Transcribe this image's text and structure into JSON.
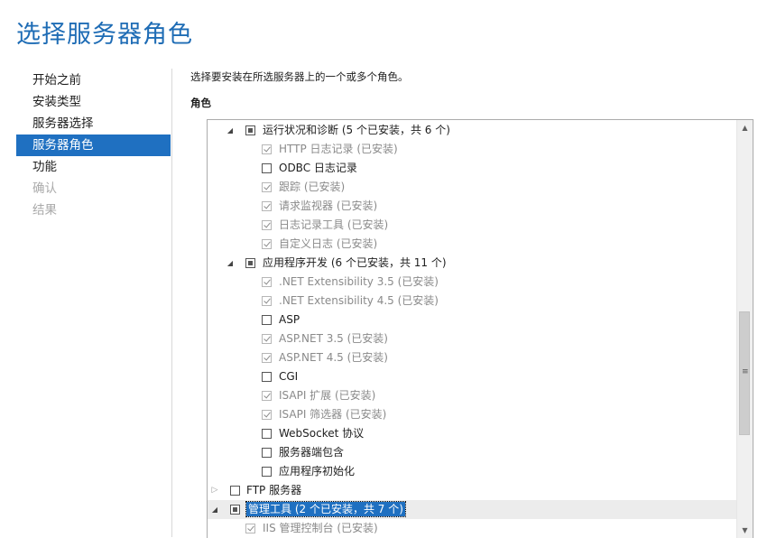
{
  "page": {
    "title": "选择服务器角色",
    "instruction": "选择要安装在所选服务器上的一个或多个角色。",
    "roles_label": "角色"
  },
  "nav": {
    "items": [
      {
        "label": "开始之前",
        "state": "normal"
      },
      {
        "label": "安装类型",
        "state": "normal"
      },
      {
        "label": "服务器选择",
        "state": "normal"
      },
      {
        "label": "服务器角色",
        "state": "active"
      },
      {
        "label": "功能",
        "state": "normal"
      },
      {
        "label": "确认",
        "state": "disabled"
      },
      {
        "label": "结果",
        "state": "disabled"
      }
    ]
  },
  "roles": {
    "rows": [
      {
        "level": 1,
        "expander": "expanded",
        "checkbox": "partial",
        "label": "运行状况和诊断 (5 个已安装，共 6 个)",
        "installed": false
      },
      {
        "level": 2,
        "checkbox": "checked",
        "label": "HTTP 日志记录 (已安装)",
        "installed": true
      },
      {
        "level": 2,
        "checkbox": "unchecked",
        "label": "ODBC 日志记录",
        "installed": false
      },
      {
        "level": 2,
        "checkbox": "checked",
        "label": "跟踪 (已安装)",
        "installed": true
      },
      {
        "level": 2,
        "checkbox": "checked",
        "label": "请求监视器 (已安装)",
        "installed": true
      },
      {
        "level": 2,
        "checkbox": "checked",
        "label": "日志记录工具 (已安装)",
        "installed": true
      },
      {
        "level": 2,
        "checkbox": "checked",
        "label": "自定义日志 (已安装)",
        "installed": true
      },
      {
        "level": 1,
        "expander": "expanded",
        "checkbox": "partial",
        "label": "应用程序开发 (6 个已安装，共 11 个)",
        "installed": false
      },
      {
        "level": 2,
        "checkbox": "checked",
        "label": ".NET Extensibility 3.5 (已安装)",
        "installed": true
      },
      {
        "level": 2,
        "checkbox": "checked",
        "label": ".NET Extensibility 4.5 (已安装)",
        "installed": true
      },
      {
        "level": 2,
        "checkbox": "unchecked",
        "label": "ASP",
        "installed": false
      },
      {
        "level": 2,
        "checkbox": "checked",
        "label": "ASP.NET 3.5 (已安装)",
        "installed": true
      },
      {
        "level": 2,
        "checkbox": "checked",
        "label": "ASP.NET 4.5 (已安装)",
        "installed": true
      },
      {
        "level": 2,
        "checkbox": "unchecked",
        "label": "CGI",
        "installed": false
      },
      {
        "level": 2,
        "checkbox": "checked",
        "label": "ISAPI 扩展 (已安装)",
        "installed": true
      },
      {
        "level": 2,
        "checkbox": "checked",
        "label": "ISAPI 筛选器 (已安装)",
        "installed": true
      },
      {
        "level": 2,
        "checkbox": "unchecked",
        "label": "WebSocket 协议",
        "installed": false
      },
      {
        "level": 2,
        "checkbox": "unchecked",
        "label": "服务器端包含",
        "installed": false
      },
      {
        "level": 2,
        "checkbox": "unchecked",
        "label": "应用程序初始化",
        "installed": false
      },
      {
        "level": 0,
        "expander": "collapsed",
        "checkbox": "unchecked",
        "label": "FTP 服务器",
        "installed": false
      },
      {
        "level": 0,
        "expander": "expanded",
        "checkbox": "partial",
        "label": "管理工具 (2 个已安装，共 7 个)",
        "installed": false,
        "selected": true
      },
      {
        "level": 1,
        "checkbox": "checked",
        "label": "IIS 管理控制台 (已安装)",
        "installed": true
      }
    ]
  },
  "scrollbar": {
    "up_arrow": "▲",
    "down_arrow": "▼",
    "grip": "≡"
  },
  "colors": {
    "title": "#1e6cb5",
    "active_nav": "#1f70c1",
    "installed_text": "#8a8a8a"
  }
}
